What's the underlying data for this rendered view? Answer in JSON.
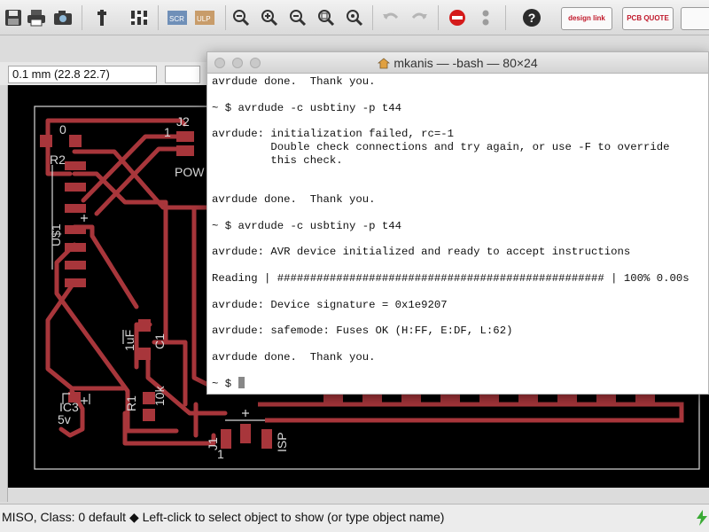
{
  "toolbar": {
    "icons": [
      "save-icon",
      "print-icon",
      "camera-icon",
      "grid-icon",
      "layers-icon",
      "script-icon",
      "ulp-icon",
      "zoom-fit-icon",
      "zoom-in-icon",
      "zoom-out-icon",
      "zoom-select-icon",
      "zoom-redraw-icon",
      "undo-icon",
      "redo-icon",
      "stop-icon",
      "go-icon",
      "help-icon"
    ],
    "designlink_label": "design link",
    "pcbquote_label": "PCB QUOTE"
  },
  "coord_display": "0.1 mm (22.8 22.7)",
  "canvas": {
    "labels": {
      "r2_pin": "0",
      "r2": "R2",
      "j2": "J2",
      "j2_pin": "1",
      "power": "POW",
      "us1": "U$1",
      "c1": "C1",
      "c1_value": "1uF",
      "r1": "R1",
      "r1_value": "10k",
      "ic3": "IC3",
      "ic3_value": "5v",
      "j1": "J1",
      "j1_pin": "1",
      "isp": "ISP"
    }
  },
  "terminal": {
    "title": "mkanis — -bash — 80×24",
    "lines": [
      "avrdude done.  Thank you.",
      "",
      "~ $ avrdude -c usbtiny -p t44",
      "",
      "avrdude: initialization failed, rc=-1",
      "         Double check connections and try again, or use -F to override",
      "         this check.",
      "",
      "",
      "avrdude done.  Thank you.",
      "",
      "~ $ avrdude -c usbtiny -p t44",
      "",
      "avrdude: AVR device initialized and ready to accept instructions",
      "",
      "Reading | ################################################## | 100% 0.00s",
      "",
      "avrdude: Device signature = 0x1e9207",
      "",
      "avrdude: safemode: Fuses OK (H:FF, E:DF, L:62)",
      "",
      "avrdude done.  Thank you.",
      ""
    ],
    "prompt": "~ $ "
  },
  "status": {
    "text": "MISO, Class: 0 default  ◆ Left-click to select object to show (or type object name)"
  },
  "colors": {
    "trace": "#a8363b",
    "pad": "#a8363b",
    "silkscreen": "#d8d8d8",
    "board_bg": "#000000",
    "accent": "#c0182a"
  }
}
